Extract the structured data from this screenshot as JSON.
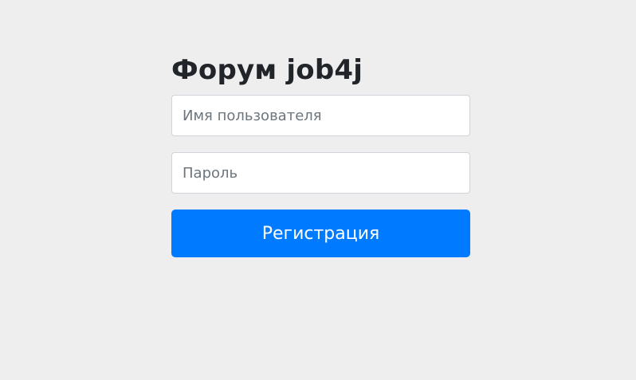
{
  "page": {
    "title": "Форум job4j",
    "background_color": "#eeeeee"
  },
  "form": {
    "username": {
      "value": "",
      "placeholder": "Имя пользователя"
    },
    "password": {
      "value": "",
      "placeholder": "Пароль"
    },
    "submit_label": "Регистрация",
    "accent_color": "#007bff"
  }
}
